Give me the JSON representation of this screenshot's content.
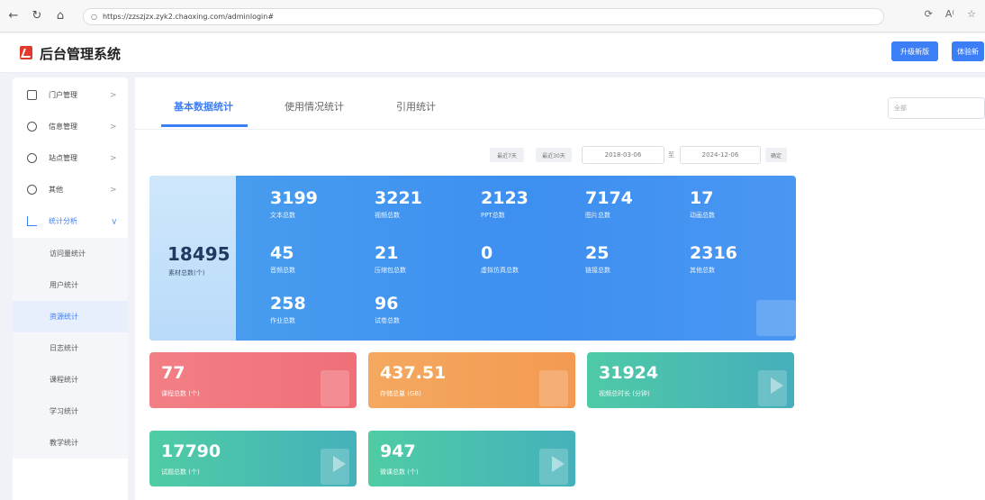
{
  "browser": {
    "url": "https://zzszjzx.zyk2.chaoxing.com/adminlogin#"
  },
  "header": {
    "title": "后台管理系统",
    "btn_upgrade": "升级新版",
    "btn_try": "体验新"
  },
  "sidebar": {
    "items": [
      {
        "label": "门户管理"
      },
      {
        "label": "信息管理"
      },
      {
        "label": "站点管理"
      },
      {
        "label": "其他"
      },
      {
        "label": "统计分析"
      }
    ],
    "sub_items": [
      {
        "label": "访问量统计"
      },
      {
        "label": "用户统计"
      },
      {
        "label": "资源统计"
      },
      {
        "label": "日志统计"
      },
      {
        "label": "课程统计"
      },
      {
        "label": "学习统计"
      },
      {
        "label": "教学统计"
      }
    ]
  },
  "tabs": [
    {
      "label": "基本数据统计"
    },
    {
      "label": "使用情况统计"
    },
    {
      "label": "引用统计"
    }
  ],
  "filter": {
    "select_value": "全部",
    "last7": "最近7天",
    "last30": "最近30天",
    "date_from": "2018-03-06",
    "separator": "至",
    "date_to": "2024-12-06",
    "confirm": "确定"
  },
  "summary": {
    "total_num": "18495",
    "total_label": "素材总数(个)",
    "stats": [
      {
        "num": "3199",
        "label": "文本总数"
      },
      {
        "num": "3221",
        "label": "视频总数"
      },
      {
        "num": "2123",
        "label": "PPT总数"
      },
      {
        "num": "7174",
        "label": "图片总数"
      },
      {
        "num": "17",
        "label": "动画总数"
      },
      {
        "num": "45",
        "label": "音频总数"
      },
      {
        "num": "21",
        "label": "压缩包总数"
      },
      {
        "num": "0",
        "label": "虚拟仿真总数"
      },
      {
        "num": "25",
        "label": "链接总数"
      },
      {
        "num": "2316",
        "label": "其他总数"
      },
      {
        "num": "258",
        "label": "作业总数"
      },
      {
        "num": "96",
        "label": "试卷总数"
      }
    ]
  },
  "cards": [
    {
      "num": "77",
      "label": "课程总数 (个)",
      "color": "#f07d82"
    },
    {
      "num": "437.51",
      "label": "存储总量 (GB)",
      "color": "#f5a35f"
    },
    {
      "num": "31924",
      "label": "视频总时长 (分钟)",
      "color": "#4cbfb2"
    },
    {
      "num": "17790",
      "label": "试题总数 (个)",
      "color": "#47c2a6"
    },
    {
      "num": "947",
      "label": "微课总数 (个)",
      "color": "#47c2a6"
    }
  ]
}
